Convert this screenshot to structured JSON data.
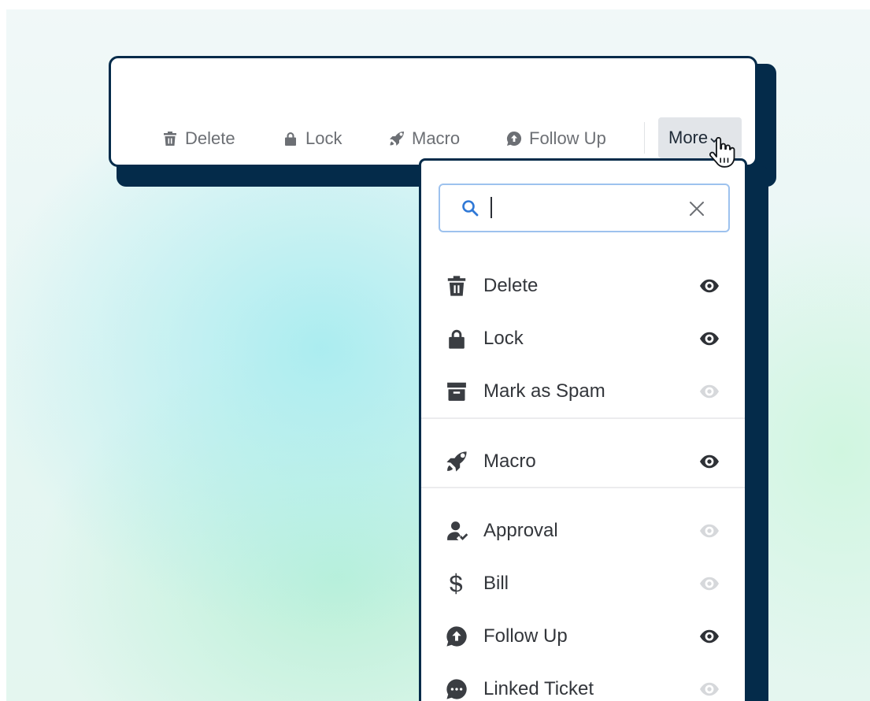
{
  "colors": {
    "frame": "#042b4a",
    "text_muted": "#6c6f74",
    "text_dark": "#33363b",
    "eye_visible": "#2e3136",
    "eye_hidden": "#d6d8db",
    "search_border": "#9dc2ee",
    "search_icon": "#2f78d6"
  },
  "toolbar": {
    "items": [
      {
        "label": "Delete",
        "icon": "trash-icon"
      },
      {
        "label": "Lock",
        "icon": "lock-icon"
      },
      {
        "label": "Macro",
        "icon": "rocket-icon"
      },
      {
        "label": "Follow Up",
        "icon": "follow-up-icon"
      }
    ],
    "more_label": "More"
  },
  "dropdown": {
    "search": {
      "value": "",
      "placeholder": ""
    },
    "items": [
      {
        "label": "Delete",
        "icon": "trash-icon",
        "visible": true
      },
      {
        "label": "Lock",
        "icon": "lock-icon",
        "visible": true
      },
      {
        "label": "Mark as Spam",
        "icon": "archive-icon",
        "visible": false
      },
      {
        "label": "Macro",
        "icon": "rocket-icon",
        "visible": true
      },
      {
        "label": "Approval",
        "icon": "user-check-icon",
        "visible": false
      },
      {
        "label": "Bill",
        "icon": "dollar-icon",
        "visible": false
      },
      {
        "label": "Follow Up",
        "icon": "follow-up-icon",
        "visible": true
      },
      {
        "label": "Linked Ticket",
        "icon": "chat-bubble-icon",
        "visible": false
      }
    ]
  }
}
